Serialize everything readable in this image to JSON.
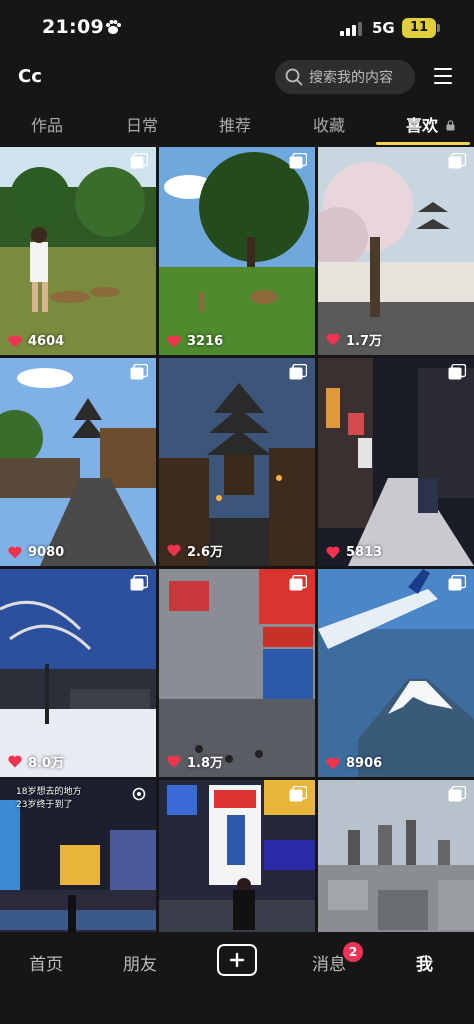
{
  "status_bar": {
    "time": "21:09",
    "network": "5G",
    "battery": "11"
  },
  "header": {
    "logo": "Cc",
    "search_placeholder": "搜索我的内容"
  },
  "tabs": [
    {
      "label": "作品",
      "active": false
    },
    {
      "label": "日常",
      "active": false
    },
    {
      "label": "推荐",
      "active": false
    },
    {
      "label": "收藏",
      "active": false
    },
    {
      "label": "喜欢",
      "active": true,
      "locked": true
    }
  ],
  "grid": [
    {
      "likes": "4604",
      "scene": "park-deer-person"
    },
    {
      "likes": "3216",
      "scene": "park-deer-tree"
    },
    {
      "likes": "1.7万",
      "scene": "cherry-blossom-pagoda"
    },
    {
      "likes": "9080",
      "scene": "kyoto-street-pagoda"
    },
    {
      "likes": "2.6万",
      "scene": "yasaka-pagoda-dusk"
    },
    {
      "likes": "5813",
      "scene": "snowy-night-street"
    },
    {
      "likes": "8.0万",
      "scene": "snowy-park"
    },
    {
      "likes": "1.8万",
      "scene": "snowy-billboards"
    },
    {
      "likes": "8906",
      "scene": "mt-fuji-plane-wing"
    },
    {
      "likes": "",
      "scene": "dotonbori-canal",
      "caption_line1": "18岁想去的地方",
      "caption_line2": "23岁终于到了"
    },
    {
      "likes": "",
      "scene": "glico-sign-person"
    },
    {
      "likes": "",
      "scene": "tokyo-skyline"
    }
  ],
  "bottom_nav": [
    {
      "label": "首页",
      "active": false
    },
    {
      "label": "朋友",
      "active": false
    },
    {
      "label": "+",
      "active": false
    },
    {
      "label": "消息",
      "active": false,
      "badge": "2"
    },
    {
      "label": "我",
      "active": true
    }
  ],
  "colors": {
    "background": "#161616",
    "accent": "#f5d34d",
    "like": "#f0334f",
    "badge": "#ee3358"
  }
}
